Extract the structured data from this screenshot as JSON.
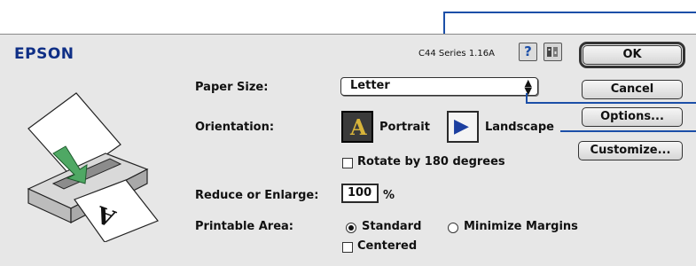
{
  "header": {
    "brand": "EPSON",
    "version": "C44 Series 1.16A"
  },
  "buttons": {
    "ok": "OK",
    "cancel": "Cancel",
    "options": "Options...",
    "customize": "Customize..."
  },
  "icons": {
    "help": "question-mark-icon",
    "about": "printer-info-icon",
    "popup_arrow": "up-down-arrow-icon",
    "portrait": "portrait-orientation-icon",
    "landscape": "landscape-orientation-icon"
  },
  "paper_size": {
    "label": "Paper Size:",
    "value": "Letter",
    "arrows": "▲▼"
  },
  "orientation": {
    "label": "Orientation:",
    "portrait": "Portrait",
    "landscape": "Landscape",
    "selected": "Portrait",
    "portrait_glyph": "A",
    "landscape_glyph": "▶"
  },
  "rotate": {
    "label": "Rotate by 180 degrees",
    "checked": false
  },
  "reduce_enlarge": {
    "label": "Reduce or Enlarge:",
    "value": "100",
    "unit": "%"
  },
  "printable_area": {
    "label": "Printable Area:",
    "standard": "Standard",
    "minimize": "Minimize Margins",
    "selected": "Standard"
  },
  "centered": {
    "label": "Centered",
    "checked": false
  },
  "colors": {
    "brand": "#0f2f86",
    "callout": "#1c4fa8",
    "dialog_bg": "#e7e7e7"
  }
}
